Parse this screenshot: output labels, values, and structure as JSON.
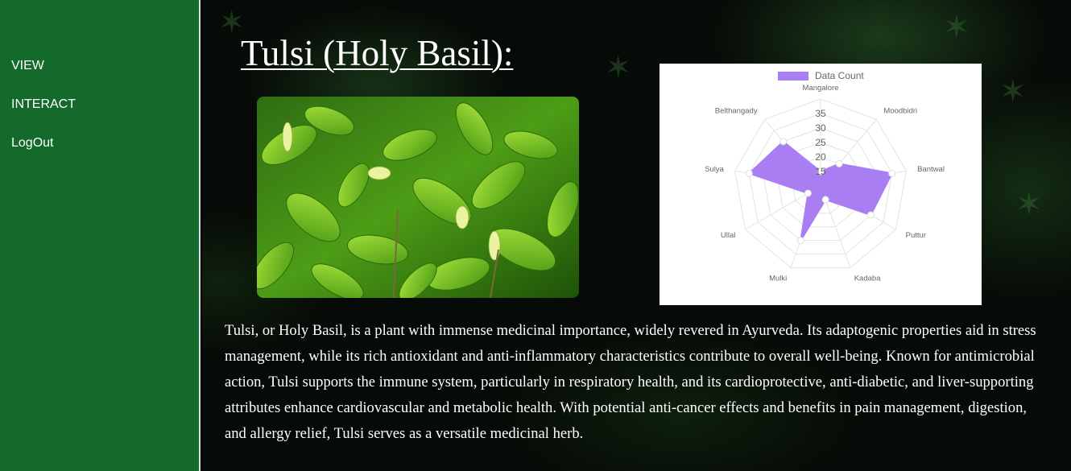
{
  "sidebar": {
    "items": [
      {
        "label": "VIEW"
      },
      {
        "label": "INTERACT"
      },
      {
        "label": "LogOut"
      }
    ]
  },
  "main": {
    "title": "Tulsi (Holy Basil):",
    "description": "Tulsi, or Holy Basil, is a plant with immense medicinal importance, widely revered in Ayurveda. Its adaptogenic properties aid in stress management, while its rich antioxidant and anti-inflammatory characteristics contribute to overall well-being. Known for antimicrobial action, Tulsi supports the immune system, particularly in respiratory health, and its cardioprotective, anti-diabetic, and liver-supporting attributes enhance cardiovascular and metabolic health. With potential anti-cancer effects and benefits in pain management, digestion, and allergy relief, Tulsi serves as a versatile medicinal herb."
  },
  "colors": {
    "sidebar": "#136a2a",
    "series_fill": "#a97ef3",
    "series_stroke": "#a97ef3"
  },
  "chart_data": {
    "type": "radar",
    "categories": [
      "Mangalore",
      "Moodbidri",
      "Bantwal",
      "Puttur",
      "Kadaba",
      "Mulki",
      "Ullal",
      "Sulya",
      "Belthangady"
    ],
    "series": [
      {
        "name": "Data Count",
        "values": [
          15,
          20,
          35,
          30,
          15,
          30,
          15,
          35,
          30
        ]
      }
    ],
    "r_ticks": [
      15,
      20,
      25,
      30,
      35
    ],
    "r_range": [
      10,
      40
    ],
    "legend": "top",
    "grid": true
  }
}
